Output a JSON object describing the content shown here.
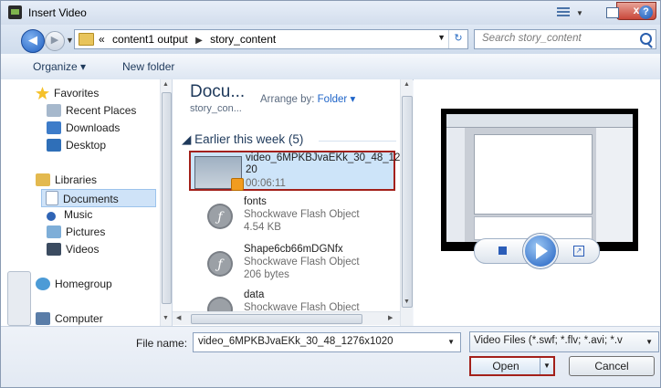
{
  "window": {
    "title": "Insert Video",
    "close_label": "x"
  },
  "address": {
    "crumbs": [
      "content1 output",
      "story_content"
    ],
    "search_placeholder": "Search story_content"
  },
  "toolbar": {
    "organize_label": "Organize ▾",
    "new_folder_label": "New folder"
  },
  "nav": {
    "favorites": "Favorites",
    "recent_places": "Recent Places",
    "downloads": "Downloads",
    "desktop": "Desktop",
    "libraries": "Libraries",
    "documents": "Documents",
    "music": "Music",
    "pictures": "Pictures",
    "videos": "Videos",
    "homegroup": "Homegroup",
    "computer": "Computer"
  },
  "library": {
    "title": "Docu...",
    "subtitle": "story_con...",
    "arrange_label": "Arrange by:",
    "arrange_value": "Folder ▾",
    "group_header": "Earlier this week (5)"
  },
  "files": [
    {
      "name": "video_6MPKBJvaEKk_30_48_12\n20",
      "desc": "00:06:11"
    },
    {
      "name": "fonts",
      "type": "Shockwave Flash Object",
      "size": "4.54 KB"
    },
    {
      "name": "Shape6cb66mDGNfx",
      "type": "Shockwave Flash Object",
      "size": "206 bytes"
    },
    {
      "name": "data",
      "type": "Shockwave Flash Object",
      "size": ""
    }
  ],
  "footer": {
    "file_name_label": "File name:",
    "file_name_value": "video_6MPKBJvaEKk_30_48_1276x1020",
    "file_type_value": "Video Files (*.swf; *.flv; *.avi; *.v",
    "open_label": "Open",
    "cancel_label": "Cancel"
  },
  "colors": {
    "accent": "#1e395b",
    "selection": "#cde4f9",
    "highlight_border": "#a3201a"
  }
}
